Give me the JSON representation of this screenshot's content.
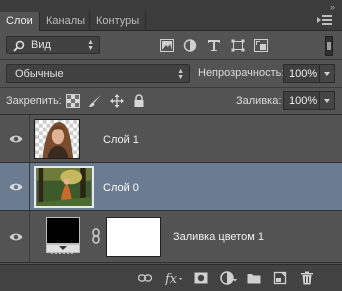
{
  "tabs": [
    {
      "label": "Слои",
      "active": true
    },
    {
      "label": "Каналы",
      "active": false
    },
    {
      "label": "Контуры",
      "active": false
    }
  ],
  "collapse_glyph": "»",
  "filter": {
    "kind_label": "Вид"
  },
  "blend": {
    "mode": "Обычные",
    "opacity_label": "Непрозрачность:",
    "opacity_value": "100%"
  },
  "lock": {
    "label": "Закрепить:",
    "fill_label": "Заливка:",
    "fill_value": "100%"
  },
  "layers": [
    {
      "name": "Слой 1",
      "visible": true,
      "selected": false
    },
    {
      "name": "Слой 0",
      "visible": true,
      "selected": true
    },
    {
      "name": "Заливка цветом 1",
      "visible": true,
      "selected": false
    }
  ],
  "colors": {
    "panel_bg": "#535353",
    "selected_row": "#6b7b90",
    "tab_bar": "#3c3c3c"
  },
  "icons": {
    "filter_row": [
      "image-filter-icon",
      "adjustment-filter-icon",
      "type-filter-icon",
      "shape-filter-icon",
      "smart-object-filter-icon"
    ],
    "lock_row": [
      "lock-transparency-icon",
      "lock-image-pixels-icon",
      "lock-position-icon",
      "lock-all-icon"
    ],
    "bottom_bar": [
      "link-layers-icon",
      "fx-icon",
      "add-mask-icon",
      "adjustment-layer-icon",
      "new-group-icon",
      "new-layer-icon",
      "delete-layer-icon"
    ]
  }
}
